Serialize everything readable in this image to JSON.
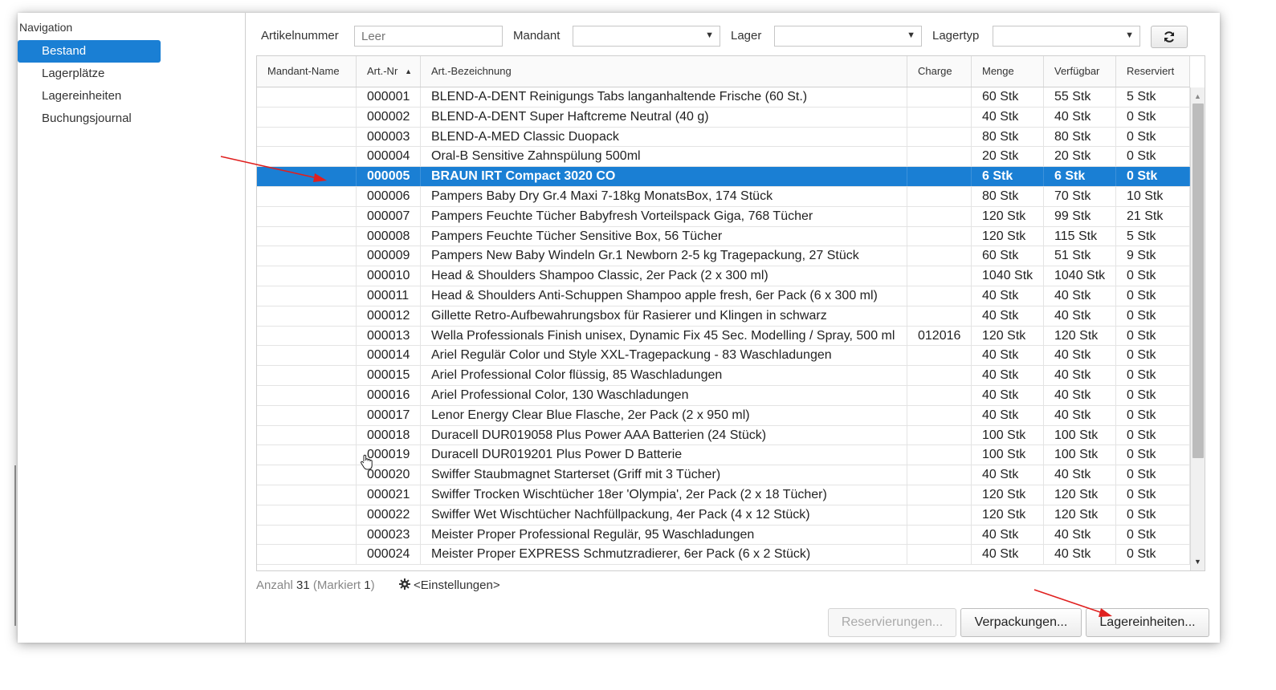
{
  "sidebar": {
    "title": "Navigation",
    "items": [
      "Bestand",
      "Lagerplätze",
      "Lagereinheiten",
      "Buchungsjournal"
    ]
  },
  "filters": {
    "artikelnummer_label": "Artikelnummer",
    "artikelnummer_placeholder": "Leer",
    "mandant_label": "Mandant",
    "lager_label": "Lager",
    "lagertyp_label": "Lagertyp"
  },
  "table": {
    "columns": [
      "Mandant-Name",
      "Art.-Nr",
      "Art.-Bezeichnung",
      "Charge",
      "Menge",
      "Verfügbar",
      "Reserviert"
    ],
    "selected_row": 4,
    "rows": [
      [
        "",
        "000001",
        "BLEND-A-DENT Reinigungs Tabs langanhaltende Frische (60 St.)",
        "",
        "60 Stk",
        "55 Stk",
        "5 Stk"
      ],
      [
        "",
        "000002",
        "BLEND-A-DENT Super Haftcreme Neutral (40 g)",
        "",
        "40 Stk",
        "40 Stk",
        "0 Stk"
      ],
      [
        "",
        "000003",
        "BLEND-A-MED Classic Duopack",
        "",
        "80 Stk",
        "80 Stk",
        "0 Stk"
      ],
      [
        "",
        "000004",
        "Oral-B Sensitive Zahnspülung 500ml",
        "",
        "20 Stk",
        "20 Stk",
        "0 Stk"
      ],
      [
        "",
        "000005",
        "BRAUN IRT Compact 3020 CO",
        "",
        "6 Stk",
        "6 Stk",
        "0 Stk"
      ],
      [
        "",
        "000006",
        "Pampers Baby Dry Gr.4 Maxi 7-18kg MonatsBox, 174 Stück",
        "",
        "80 Stk",
        "70 Stk",
        "10 Stk"
      ],
      [
        "",
        "000007",
        "Pampers Feuchte Tücher Babyfresh Vorteilspack Giga, 768 Tücher",
        "",
        "120 Stk",
        "99 Stk",
        "21 Stk"
      ],
      [
        "",
        "000008",
        "Pampers Feuchte Tücher Sensitive Box, 56 Tücher",
        "",
        "120 Stk",
        "115 Stk",
        "5 Stk"
      ],
      [
        "",
        "000009",
        "Pampers New Baby Windeln Gr.1 Newborn 2-5 kg Tragepackung, 27 Stück",
        "",
        "60 Stk",
        "51 Stk",
        "9 Stk"
      ],
      [
        "",
        "000010",
        "Head & Shoulders Shampoo Classic, 2er Pack (2 x 300 ml)",
        "",
        "1040 Stk",
        "1040 Stk",
        "0 Stk"
      ],
      [
        "",
        "000011",
        "Head & Shoulders Anti-Schuppen Shampoo apple fresh, 6er Pack (6 x 300 ml)",
        "",
        "40 Stk",
        "40 Stk",
        "0 Stk"
      ],
      [
        "",
        "000012",
        "Gillette Retro-Aufbewahrungsbox für Rasierer und Klingen in schwarz",
        "",
        "40 Stk",
        "40 Stk",
        "0 Stk"
      ],
      [
        "",
        "000013",
        "Wella Professionals Finish unisex, Dynamic Fix 45 Sec. Modelling / Spray, 500 ml",
        "012016",
        "120 Stk",
        "120 Stk",
        "0 Stk"
      ],
      [
        "",
        "000014",
        "Ariel Regulär Color und Style XXL-Tragepackung - 83 Waschladungen",
        "",
        "40 Stk",
        "40 Stk",
        "0 Stk"
      ],
      [
        "",
        "000015",
        "Ariel Professional Color flüssig, 85 Waschladungen",
        "",
        "40 Stk",
        "40 Stk",
        "0 Stk"
      ],
      [
        "",
        "000016",
        "Ariel Professional Color, 130 Waschladungen",
        "",
        "40 Stk",
        "40 Stk",
        "0 Stk"
      ],
      [
        "",
        "000017",
        "Lenor Energy Clear Blue Flasche, 2er Pack (2 x 950 ml)",
        "",
        "40 Stk",
        "40 Stk",
        "0 Stk"
      ],
      [
        "",
        "000018",
        "Duracell DUR019058 Plus Power AAA Batterien (24 Stück)",
        "",
        "100 Stk",
        "100 Stk",
        "0 Stk"
      ],
      [
        "",
        "000019",
        "Duracell DUR019201 Plus Power D Batterie",
        "",
        "100 Stk",
        "100 Stk",
        "0 Stk"
      ],
      [
        "",
        "000020",
        "Swiffer Staubmagnet Starterset (Griff mit 3 Tücher)",
        "",
        "40 Stk",
        "40 Stk",
        "0 Stk"
      ],
      [
        "",
        "000021",
        "Swiffer Trocken Wischtücher 18er 'Olympia', 2er Pack (2 x 18 Tücher)",
        "",
        "120 Stk",
        "120 Stk",
        "0 Stk"
      ],
      [
        "",
        "000022",
        "Swiffer Wet Wischtücher Nachfüllpackung, 4er Pack (4 x 12 Stück)",
        "",
        "120 Stk",
        "120 Stk",
        "0 Stk"
      ],
      [
        "",
        "000023",
        "Meister Proper Professional Regulär, 95 Waschladungen",
        "",
        "40 Stk",
        "40 Stk",
        "0 Stk"
      ],
      [
        "",
        "000024",
        "Meister Proper EXPRESS Schmutzradierer, 6er Pack (6 x 2 Stück)",
        "",
        "40 Stk",
        "40 Stk",
        "0 Stk"
      ]
    ]
  },
  "footer": {
    "count_label": "Anzahl",
    "count_value": "31",
    "marked_label": "(Markiert",
    "marked_value": "1",
    "marked_close": ")",
    "settings_label": "<Einstellungen>"
  },
  "buttons": {
    "reservierungen": "Reservierungen...",
    "verpackungen": "Verpackungen...",
    "lagereinheiten": "Lagereinheiten..."
  },
  "colors": {
    "accent": "#1a7fd4",
    "annotation_arrow": "#e0201f"
  }
}
